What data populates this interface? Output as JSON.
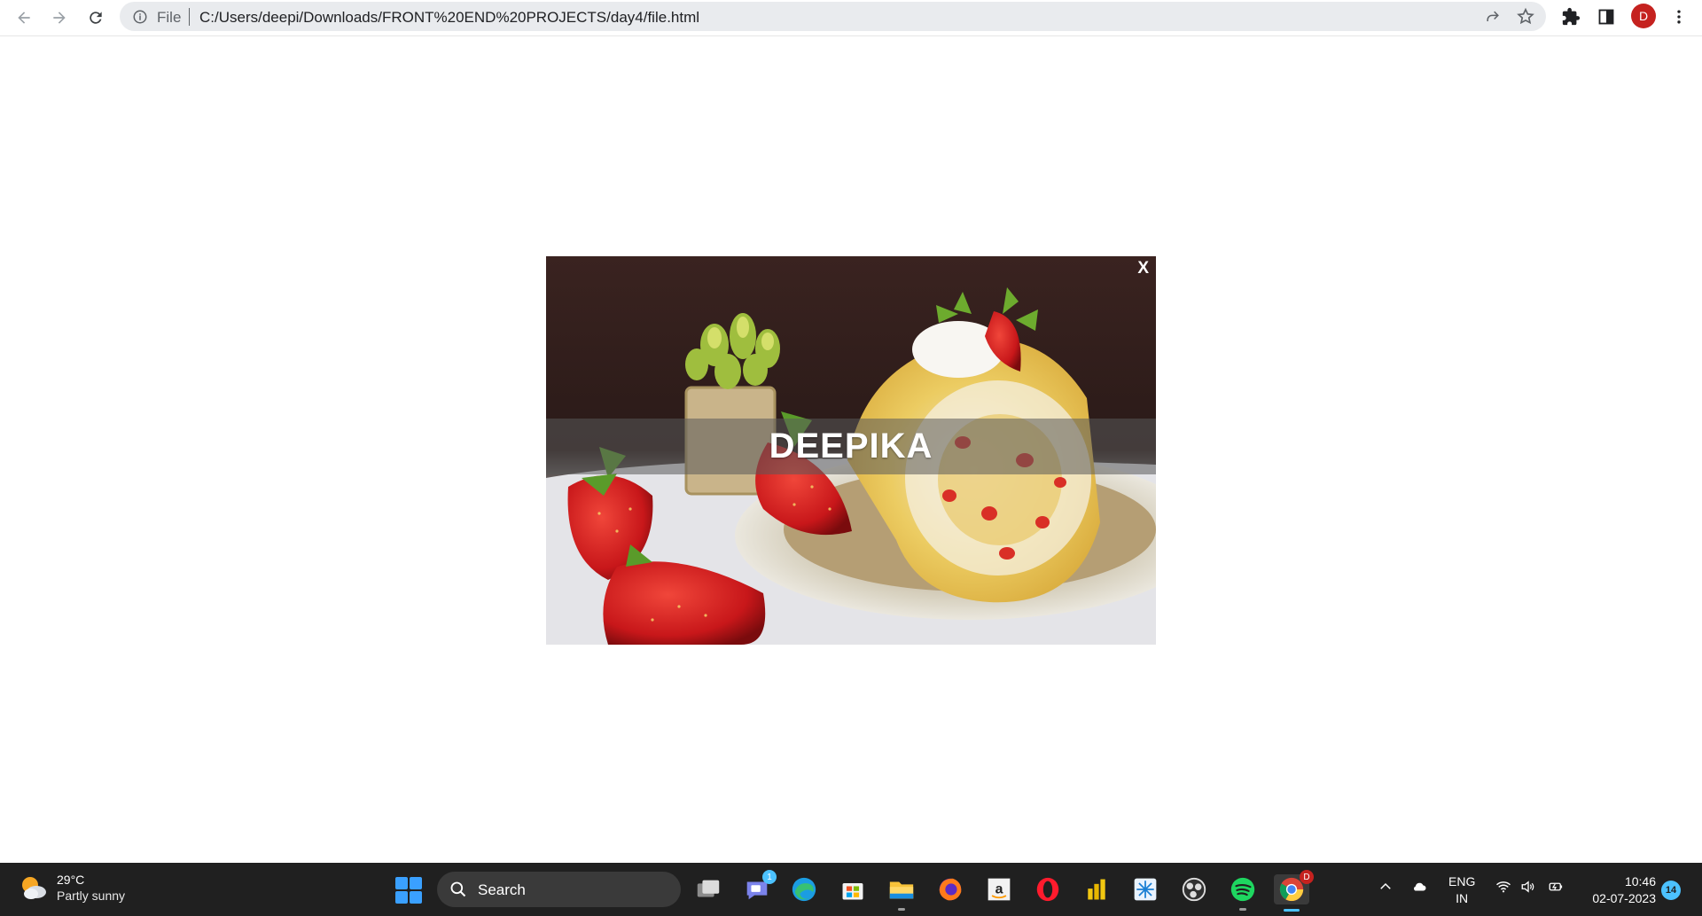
{
  "browser": {
    "scheme_label": "File",
    "url": "C:/Users/deepi/Downloads/FRONT%20END%20PROJECTS/day4/file.html",
    "profile_initial": "D",
    "profile_color": "#c5221f"
  },
  "page": {
    "close_label": "X",
    "banner_text": "DEEPIKA",
    "image_subject": "strawberry cream roll cake with fresh strawberries and succulent plant"
  },
  "taskbar": {
    "weather": {
      "temp": "29°C",
      "desc": "Partly sunny"
    },
    "search_label": "Search",
    "chat_badge": "1",
    "lang_top": "ENG",
    "lang_bottom": "IN",
    "time": "10:46",
    "date": "02-07-2023",
    "notifications": "14",
    "chrome_badge": "D"
  },
  "colors": {
    "accent": "#4cc2ff",
    "taskbar_bg": "#202020"
  }
}
